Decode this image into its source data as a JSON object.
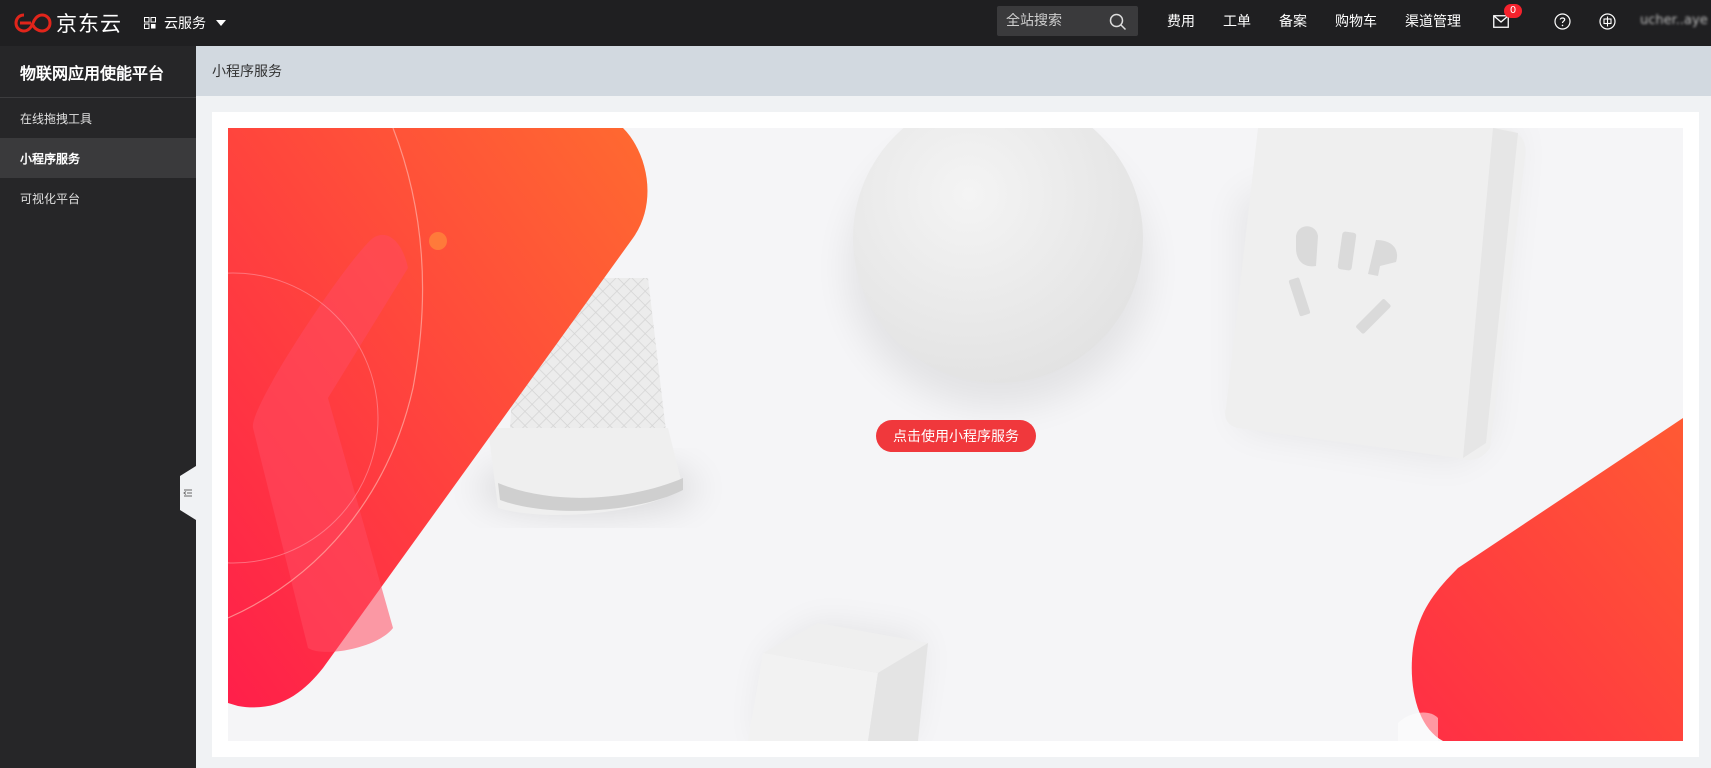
{
  "topbar": {
    "brand_name": "京东云",
    "brand_icon": "jd-cloud-logo-icon",
    "service_menu_label": "云服务",
    "search_placeholder": "全站搜索",
    "nav_links": [
      "费用",
      "工单",
      "备案",
      "购物车",
      "渠道管理"
    ],
    "mail_badge_count": "0",
    "username": "ucher..aye",
    "icons": [
      "mail-icon",
      "help-icon",
      "language-icon"
    ]
  },
  "sidebar": {
    "title": "物联网应用使能平台",
    "items": [
      {
        "label": "在线拖拽工具",
        "active": false
      },
      {
        "label": "小程序服务",
        "active": true
      },
      {
        "label": "可视化平台",
        "active": false
      }
    ]
  },
  "content": {
    "breadcrumb": "小程序服务",
    "cta_label": "点击使用小程序服务"
  },
  "colors": {
    "accent": "#f0383c",
    "topbar_bg": "#1f1f21",
    "sidebar_bg": "#262628"
  }
}
